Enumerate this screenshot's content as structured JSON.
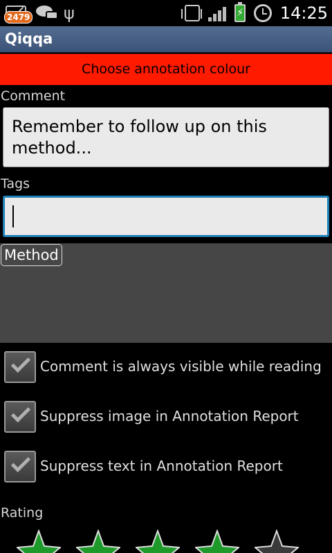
{
  "status_bar": {
    "notification_count": "2479",
    "time": "14:25",
    "icons": [
      "mail-icon",
      "chat-icon",
      "usb-icon",
      "vibrate-icon",
      "signal-icon",
      "battery-charging-icon",
      "alarm-icon"
    ]
  },
  "app_bar": {
    "title": "Qiqqa"
  },
  "colour_button": {
    "label": "Choose annotation colour",
    "color": "#ff1a00"
  },
  "comment": {
    "label": "Comment",
    "value": "Remember to follow up on this method..."
  },
  "tags": {
    "label": "Tags",
    "value": ""
  },
  "method_panel": {
    "chip_label": "Method"
  },
  "checkboxes": [
    {
      "label": "Comment is always visible while reading",
      "checked": true
    },
    {
      "label": "Suppress image in Annotation Report",
      "checked": true
    },
    {
      "label": "Suppress text in Annotation Report",
      "checked": true
    }
  ],
  "rating": {
    "label": "Rating",
    "stars": 5,
    "value_filled": 4
  }
}
